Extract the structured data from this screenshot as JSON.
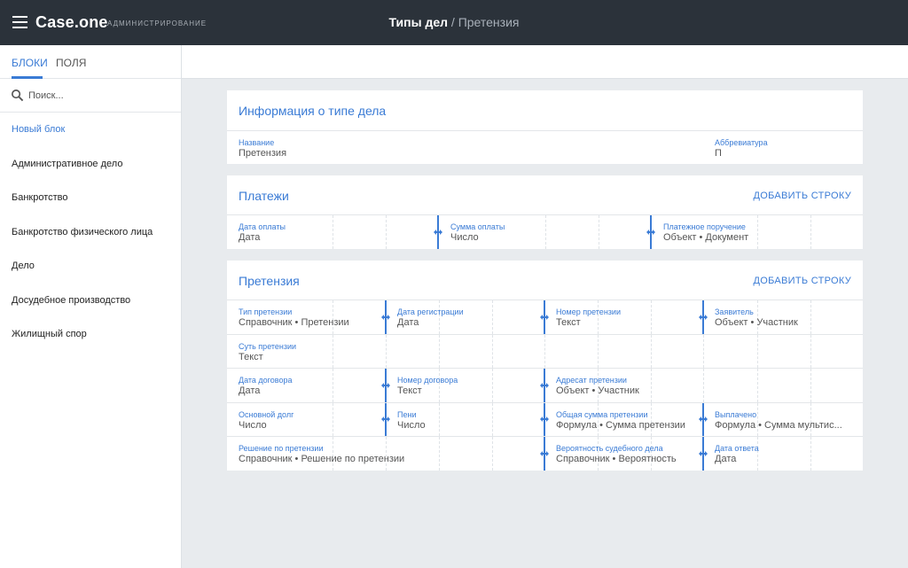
{
  "header": {
    "brand": "Case.one",
    "brand_sub": "АДМИНИСТРИРОВАНИЕ",
    "title_main": "Типы дел",
    "title_sep": " / ",
    "title_sub": "Претензия",
    "bg_color": "#2b323a",
    "accent_color": "#3a7bd5"
  },
  "sidebar": {
    "tabs": [
      {
        "label": "БЛОКИ",
        "active": true
      },
      {
        "label": "ПОЛЯ",
        "active": false
      }
    ],
    "search_placeholder": "Поиск...",
    "items": [
      {
        "label": "Новый блок"
      },
      {
        "label": "Административное дело"
      },
      {
        "label": "Банкротство"
      },
      {
        "label": "Банкротство физического лица"
      },
      {
        "label": "Дело"
      },
      {
        "label": "Досудебное производство"
      },
      {
        "label": "Жилищный спор"
      }
    ]
  },
  "info_card": {
    "title": "Информация о типе дела",
    "fields": [
      {
        "label": "Название",
        "value": "Претензия"
      },
      {
        "label": "Аббревиатура",
        "value": "П"
      }
    ]
  },
  "payments_card": {
    "title": "Платежи",
    "add_label": "ДОБАВИТЬ СТРОКУ",
    "fields": [
      {
        "label": "Дата оплаты",
        "value": "Дата"
      },
      {
        "label": "Сумма оплаты",
        "value": "Число"
      },
      {
        "label": "Платежное поручение",
        "value": "Объект • Документ"
      }
    ]
  },
  "claim_card": {
    "title": "Претензия",
    "add_label": "ДОБАВИТЬ СТРОКУ",
    "rows": [
      [
        {
          "label": "Тип претензии",
          "value": "Справочник • Претензии"
        },
        {
          "label": "Дата регистрации",
          "value": "Дата"
        },
        {
          "label": "Номер претензии",
          "value": "Текст"
        },
        {
          "label": "Заявитель",
          "value": "Объект • Участник"
        }
      ],
      [
        {
          "label": "Суть претензии",
          "value": "Текст"
        }
      ],
      [
        {
          "label": "Дата договора",
          "value": "Дата"
        },
        {
          "label": "Номер договора",
          "value": "Текст"
        },
        {
          "label": "Адресат претензии",
          "value": "Объект • Участник"
        }
      ],
      [
        {
          "label": "Основной долг",
          "value": "Число"
        },
        {
          "label": "Пени",
          "value": "Число"
        },
        {
          "label": "Общая сумма претензии",
          "value": "Формула • Сумма претензии"
        },
        {
          "label": "Выплачено",
          "value": "Формула • Сумма мультис..."
        }
      ],
      [
        {
          "label": "Решение по претензии",
          "value": "Справочник • Решение по претензии"
        },
        {
          "label": "Вероятность судебного дела",
          "value": "Справочник • Вероятность"
        },
        {
          "label": "Дата ответа",
          "value": "Дата"
        }
      ]
    ]
  }
}
